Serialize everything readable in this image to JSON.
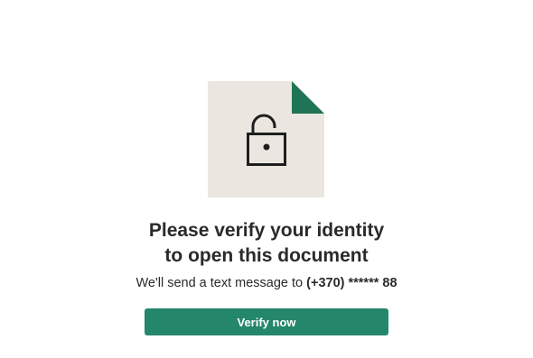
{
  "document_icon": {
    "icon": "unlocked-padlock-icon",
    "paper_color": "#ebe6df",
    "corner_color": "#1e7454",
    "lock_color": "#1e1e1e"
  },
  "heading": {
    "line1": "Please verify your identity",
    "line2": "to open this document"
  },
  "message": {
    "prefix": "We'll send a text message to ",
    "phone": "(+370) ****** 88"
  },
  "button": {
    "label": "Verify now",
    "color": "#24866a"
  }
}
